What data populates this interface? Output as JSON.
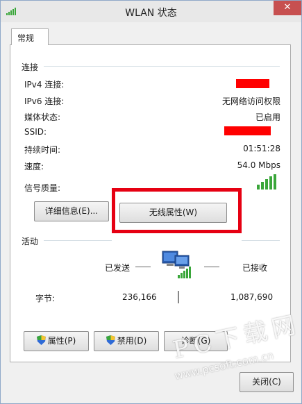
{
  "window": {
    "title": "WLAN 状态",
    "close_label": "✕"
  },
  "tab": {
    "label": "常规"
  },
  "connection": {
    "section_title": "连接",
    "rows": [
      {
        "label": "IPv4 连接:",
        "value": ""
      },
      {
        "label": "IPv6 连接:",
        "value": "无网络访问权限"
      },
      {
        "label": "媒体状态:",
        "value": "已启用"
      },
      {
        "label": "SSID:",
        "value": ""
      },
      {
        "label": "持续时间:",
        "value": "01:51:28"
      },
      {
        "label": "速度:",
        "value": "54.0 Mbps"
      },
      {
        "label": "信号质量:",
        "value": ""
      }
    ],
    "signal_level": "5/5",
    "details_button": "详细信息(E)...",
    "wireless_props_button": "无线属性(W)"
  },
  "activity": {
    "section_title": "活动",
    "sent_label": "已发送",
    "received_label": "已接收",
    "bytes_label": "字节:",
    "bytes_sent": "236,166",
    "bytes_received": "1,087,690"
  },
  "actions": {
    "properties_button": "属性(P)",
    "disable_button": "禁用(D)",
    "diagnose_button": "诊断(G)"
  },
  "footer": {
    "close_button": "关闭(C)"
  },
  "watermark": {
    "big": "PC下载网",
    "small": "www.pcsoft.com.cn"
  },
  "colors": {
    "redaction": "#ff0000",
    "highlight": "#e60012",
    "signal": "#3aa63a"
  }
}
